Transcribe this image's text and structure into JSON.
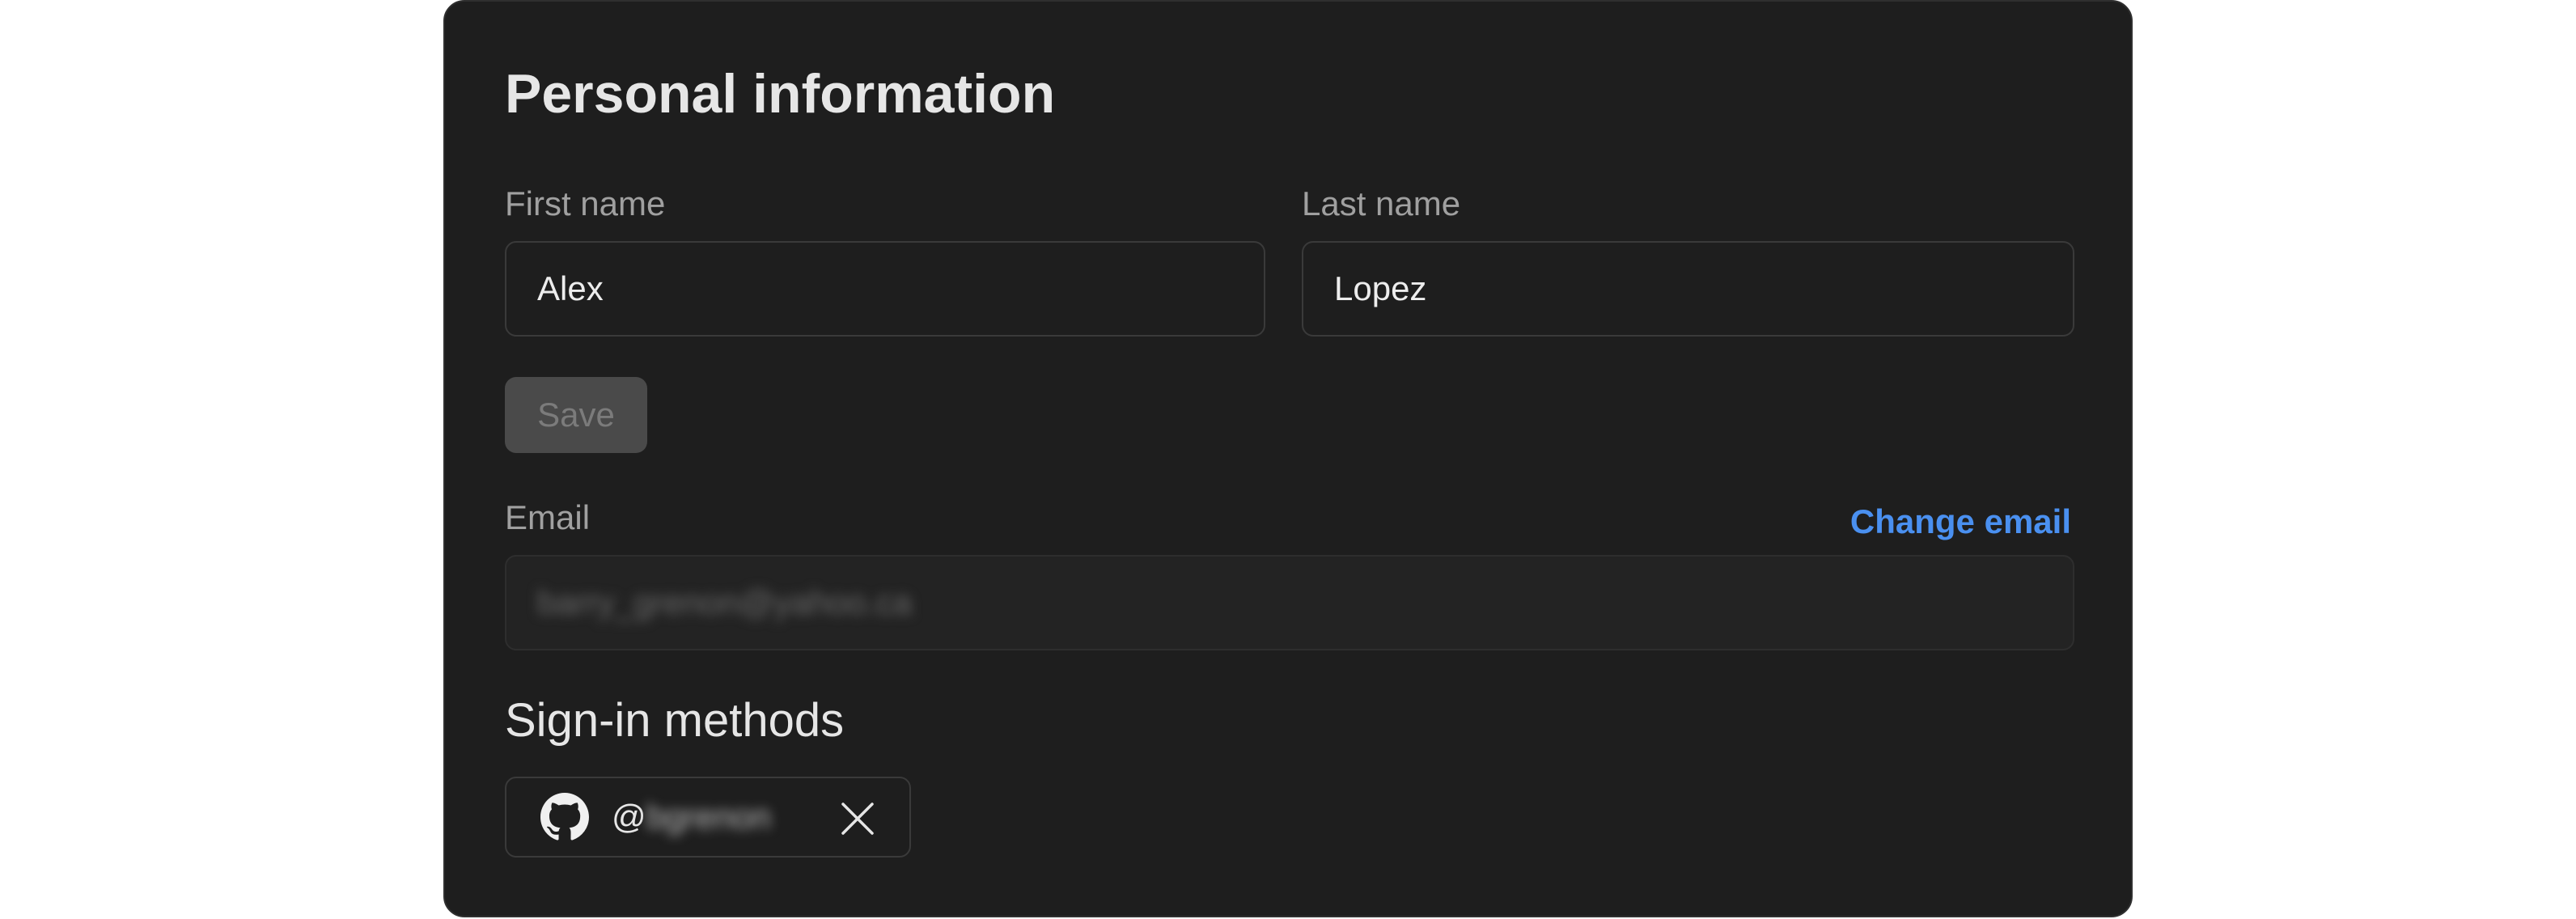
{
  "section": {
    "title": "Personal information"
  },
  "first_name": {
    "label": "First name",
    "value": "Alex"
  },
  "last_name": {
    "label": "Last name",
    "value": "Lopez"
  },
  "save": {
    "label": "Save",
    "disabled": true
  },
  "email": {
    "label": "Email",
    "value": "barry_grenon@yahoo.ca",
    "change_label": "Change email"
  },
  "signin": {
    "title": "Sign-in methods",
    "methods": [
      {
        "provider_icon": "github-icon",
        "prefix": "@",
        "handle": "bgrenon",
        "remove_icon": "close-icon"
      }
    ]
  },
  "colors": {
    "panel_bg": "#1e1e1e",
    "link": "#4a90f0",
    "disabled_button_bg": "#4a4a4a"
  }
}
